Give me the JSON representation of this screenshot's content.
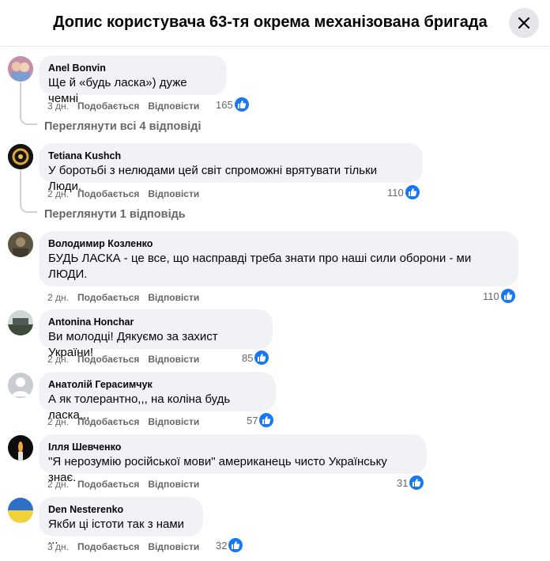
{
  "dialog": {
    "title": "Допис користувача 63-тя окрема механізована бригада",
    "close_icon": "close-icon"
  },
  "colors": {
    "like": "#1877f2",
    "bubble": "#f0f2f5",
    "secondary_text": "#65676b"
  },
  "comments": [
    {
      "author": "Anel Bonvin",
      "text": "Ще й «будь ласка») дуже чемні",
      "time": "3 дн.",
      "like_label": "Подобається",
      "reply_label": "Відповісти",
      "reactions": "165",
      "view_replies": "Переглянути всі 4 відповіді"
    },
    {
      "author": "Tetiana Kushch",
      "text": "У боротьбі з нелюдами цей світ спроможні врятувати тільки Люди.",
      "time": "2 дн.",
      "like_label": "Подобається",
      "reply_label": "Відповісти",
      "reactions": "110",
      "view_replies": "Переглянути 1 відповідь"
    },
    {
      "author": "Володимир Козленко",
      "text": "БУДЬ ЛАСКА - це все, що насправді треба знати про наші сили оборони - ми ЛЮДИ.",
      "time": "2 дн.",
      "like_label": "Подобається",
      "reply_label": "Відповісти",
      "reactions": "110"
    },
    {
      "author": "Antonina Honchar",
      "text": "Ви молодці! Дякуємо за захист України!",
      "time": "2 дн.",
      "like_label": "Подобається",
      "reply_label": "Відповісти",
      "reactions": "85"
    },
    {
      "author": "Анатолій Герасимчук",
      "text": "А як толерантно,,, на коліна будь ласка,,,",
      "time": "2 дн.",
      "like_label": "Подобається",
      "reply_label": "Відповісти",
      "reactions": "57"
    },
    {
      "author": "Ілля Шевченко",
      "text": "\"Я нерозумію російської мови\" американець чисто Українську знає.",
      "time": "2 дн.",
      "like_label": "Подобається",
      "reply_label": "Відповісти",
      "reactions": "31"
    },
    {
      "author": "Den Nesterenko",
      "text": "Якби ці істоти так з нами ...",
      "time": "3 дн.",
      "like_label": "Подобається",
      "reply_label": "Відповісти",
      "reactions": "32"
    }
  ]
}
